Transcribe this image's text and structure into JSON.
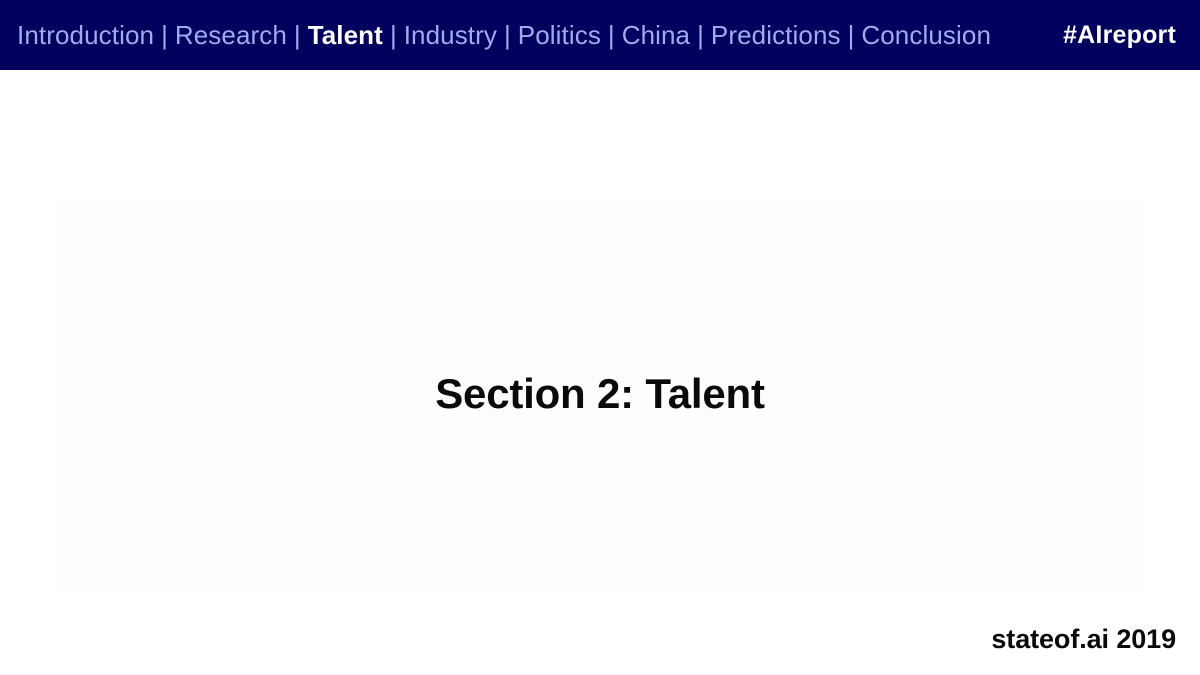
{
  "slide": {
    "background_color": "#ffffff",
    "panel_color": "#FDFDFE"
  },
  "navbar": {
    "background_color": "#02005E",
    "link_color": "#A0ABEE",
    "active_color": "#FFFFFF",
    "separator": "|",
    "items": [
      {
        "label": "Introduction",
        "active": false
      },
      {
        "label": "Research",
        "active": false
      },
      {
        "label": "Talent",
        "active": true
      },
      {
        "label": "Industry",
        "active": false
      },
      {
        "label": "Politics",
        "active": false
      },
      {
        "label": "China",
        "active": false
      },
      {
        "label": "Predictions",
        "active": false
      },
      {
        "label": "Conclusion",
        "active": false
      }
    ],
    "hashtag": "#AIreport"
  },
  "main": {
    "title": "Section 2: Talent"
  },
  "footer": {
    "brand": "stateof.ai 2019"
  }
}
